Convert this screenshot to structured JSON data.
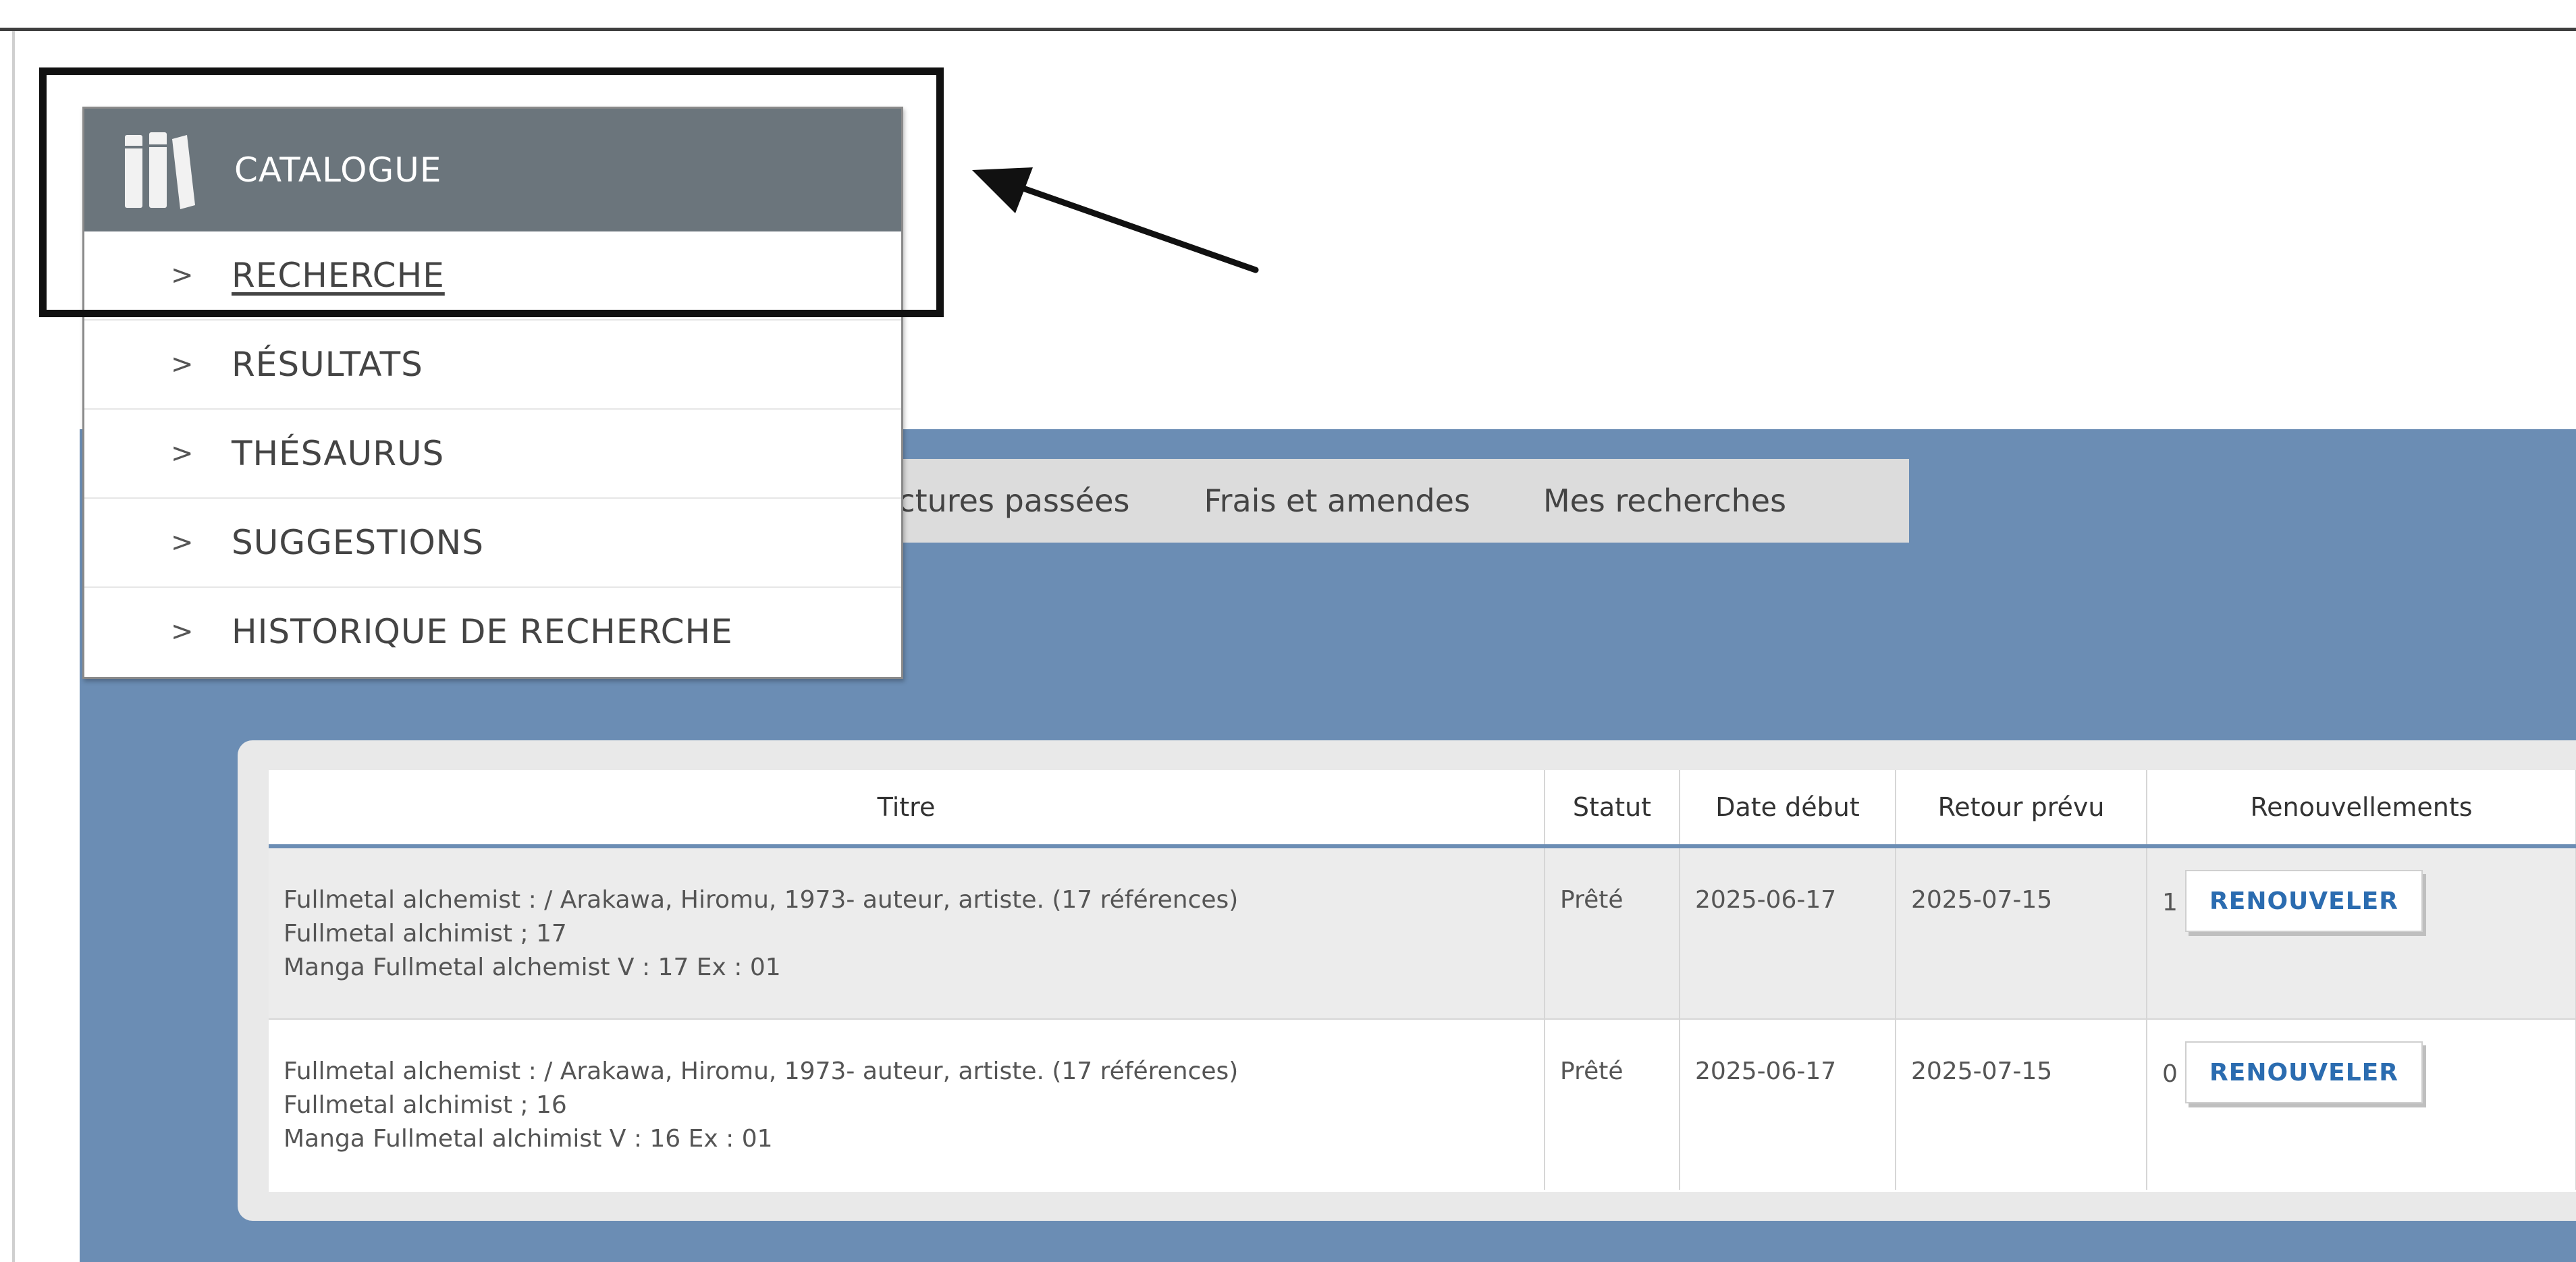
{
  "catalogue": {
    "title": "CATALOGUE",
    "icon": "books-icon",
    "items": [
      {
        "label": "RECHERCHE",
        "active": true
      },
      {
        "label": "RÉSULTATS"
      },
      {
        "label": "THÉSAURUS"
      },
      {
        "label": "SUGGESTIONS"
      },
      {
        "label": "HISTORIQUE DE RECHERCHE"
      }
    ],
    "chevron": ">"
  },
  "tabs": [
    {
      "label": "ectures passées"
    },
    {
      "label": "Frais et amendes"
    },
    {
      "label": "Mes recherches"
    }
  ],
  "loans_table": {
    "headers": [
      "Titre",
      "Statut",
      "Date début",
      "Retour prévu",
      "Renouvellements"
    ],
    "rows": [
      {
        "title_lines": [
          "Fullmetal alchemist : / Arakawa, Hiromu, 1973- auteur, artiste. (17 références)",
          "Fullmetal alchimist ; 17",
          "Manga Fullmetal alchemist V : 17 Ex : 01"
        ],
        "status": "Prêté",
        "start_date": "2025-06-17",
        "due_date": "2025-07-15",
        "renewals": "1",
        "renew_button": "RENOUVELER"
      },
      {
        "title_lines": [
          "Fullmetal alchemist : / Arakawa, Hiromu, 1973- auteur, artiste. (17 références)",
          "Fullmetal alchimist ; 16",
          "Manga Fullmetal alchimist V : 16 Ex : 01"
        ],
        "status": "Prêté",
        "start_date": "2025-06-17",
        "due_date": "2025-07-15",
        "renewals": "0",
        "renew_button": "RENOUVELER"
      }
    ]
  },
  "colors": {
    "panel_blue": "#6b8db4",
    "menu_header": "#6b757c",
    "button_text": "#2b6cb0"
  }
}
